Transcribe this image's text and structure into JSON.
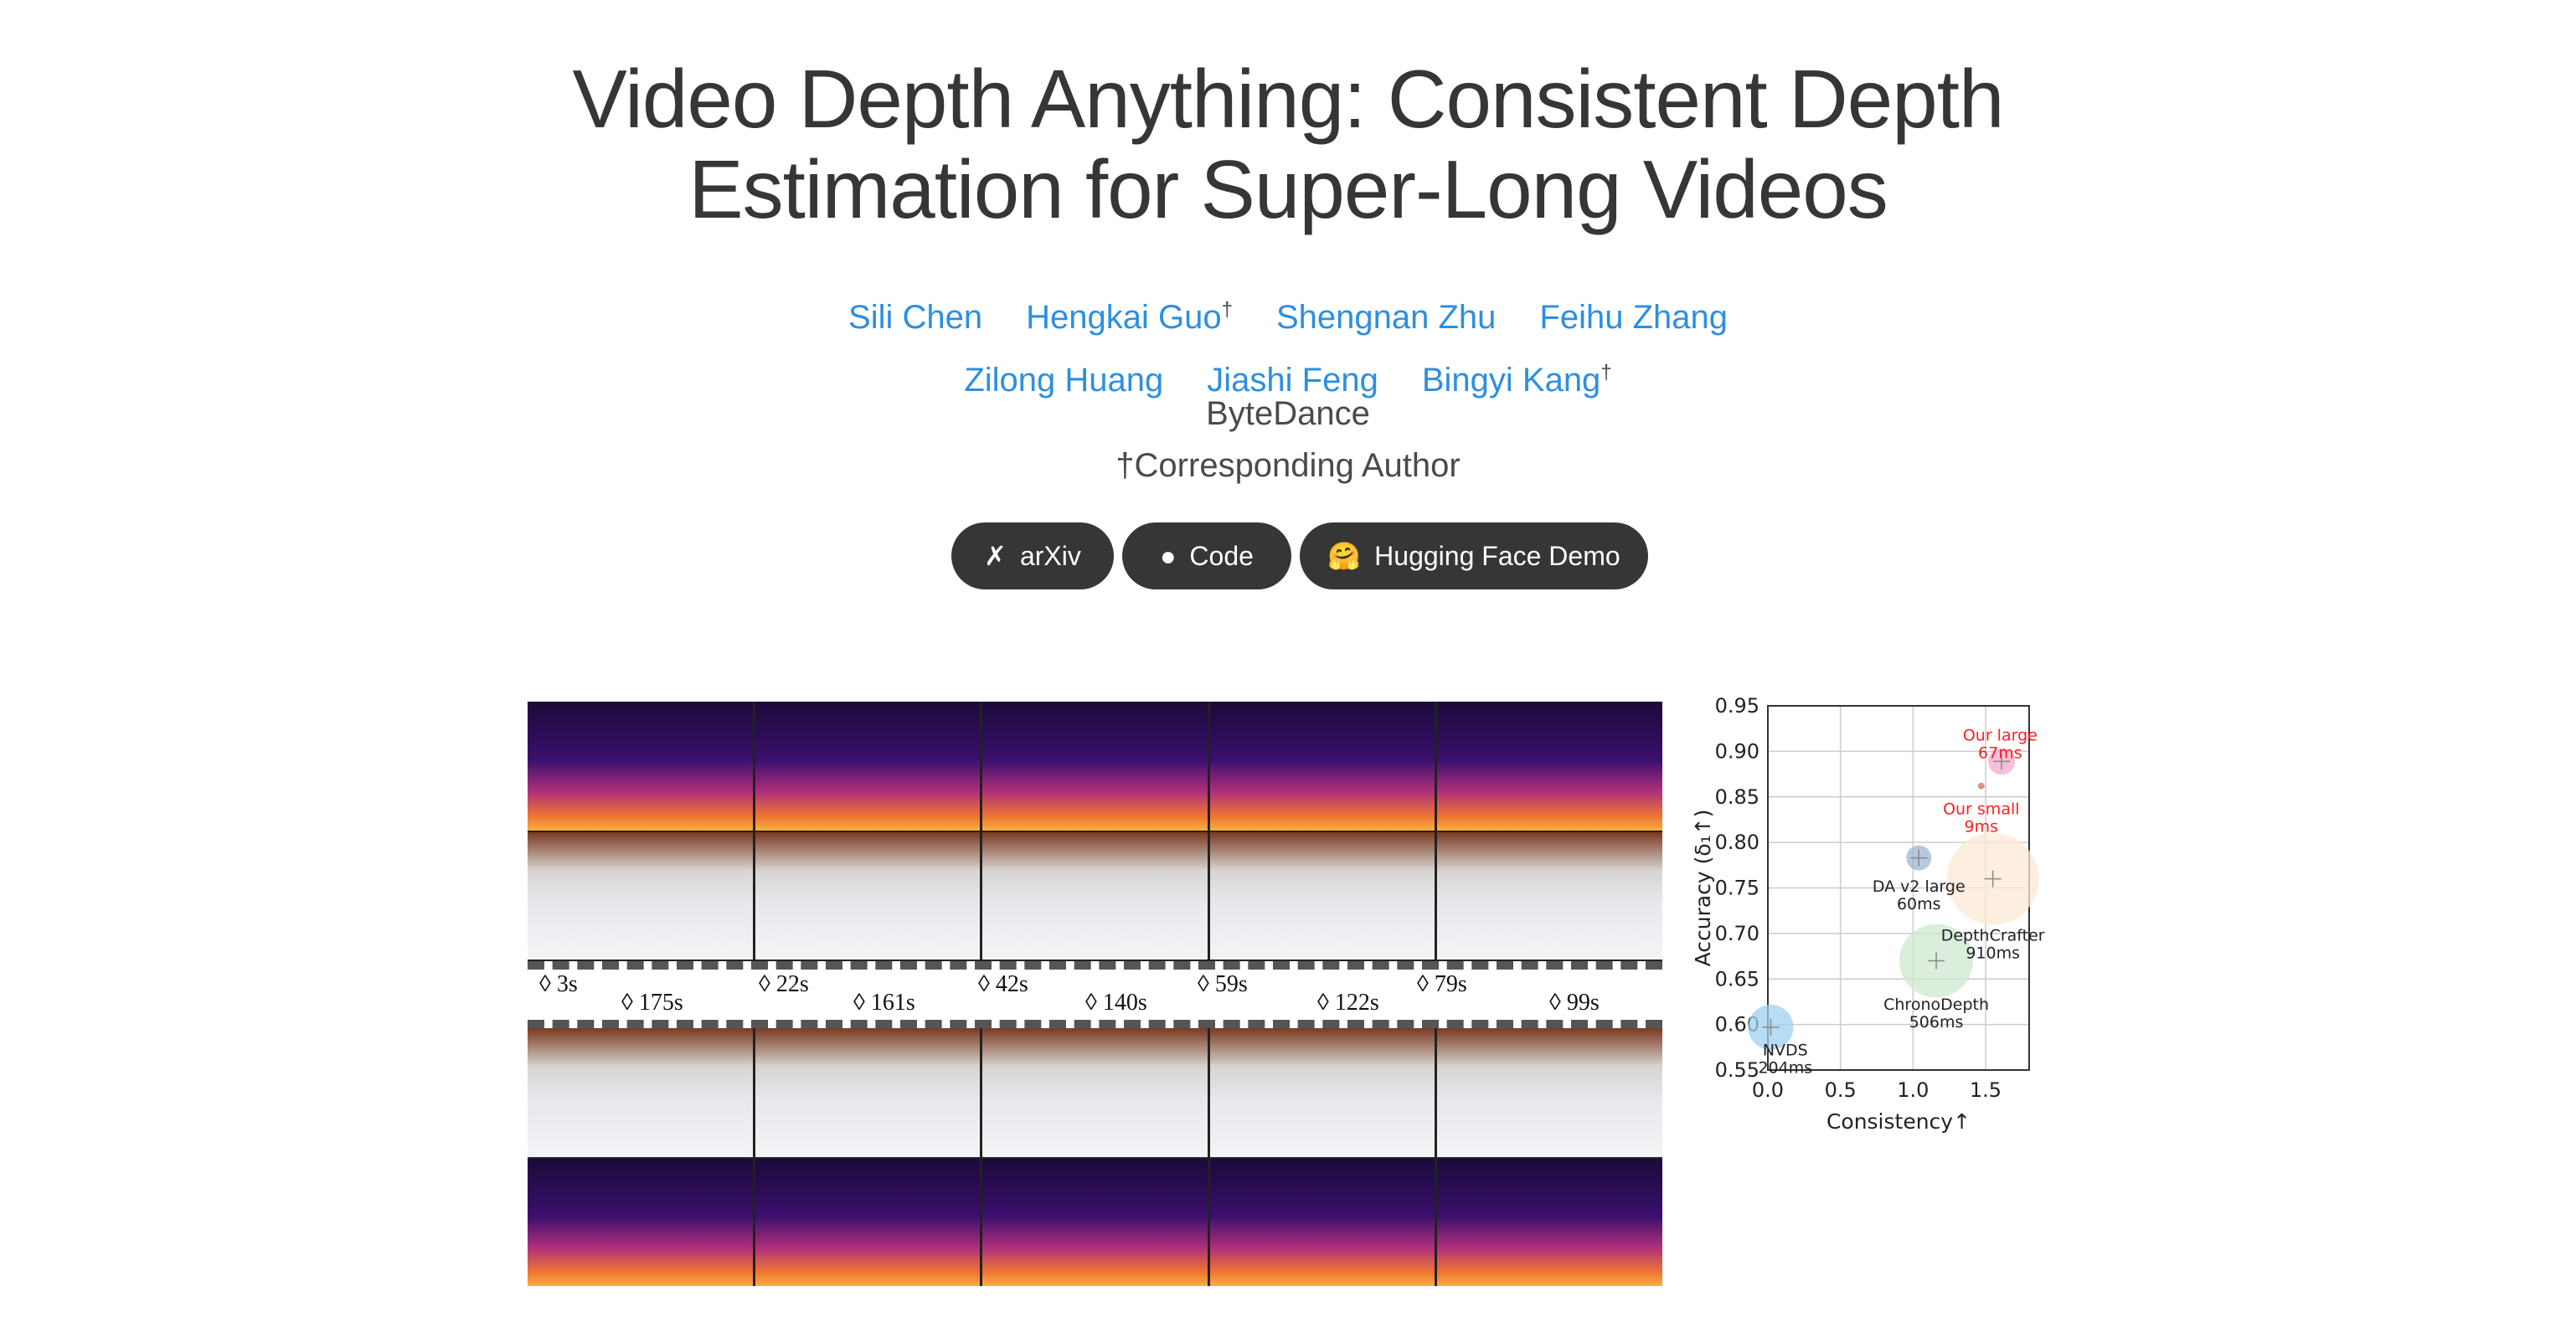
{
  "title": {
    "line1": "Video Depth Anything: Consistent Depth",
    "line2": "Estimation for Super-Long Videos"
  },
  "authors": {
    "row1": [
      {
        "name": "Sili Chen",
        "mark": ""
      },
      {
        "name": "Hengkai Guo",
        "mark": "†"
      },
      {
        "name": "Shengnan Zhu",
        "mark": ""
      },
      {
        "name": "Feihu Zhang",
        "mark": ""
      }
    ],
    "row2": [
      {
        "name": "Zilong Huang",
        "mark": ""
      },
      {
        "name": "Jiashi Feng",
        "mark": ""
      },
      {
        "name": "Bingyi Kang",
        "mark": "†"
      }
    ]
  },
  "affiliation": "ByteDance",
  "note": "†Corresponding Author",
  "buttons": [
    {
      "label": "arXiv",
      "icon": "arxiv-icon"
    },
    {
      "label": "Code",
      "icon": "github-icon"
    },
    {
      "label": "Hugging Face Demo",
      "icon": "hugging-face-icon"
    }
  ],
  "timeline": {
    "top": [
      "3s",
      "22s",
      "42s",
      "59s",
      "79s"
    ],
    "bottom": [
      "175s",
      "161s",
      "140s",
      "122s",
      "99s"
    ]
  },
  "chart_data": {
    "type": "scatter",
    "xlabel": "Consistency↑",
    "ylabel": "Accuracy (δ₁↑)",
    "xlim": [
      0,
      1.8
    ],
    "ylim": [
      0.55,
      0.95
    ],
    "xticks": [
      "0.0",
      "0.5",
      "1.0",
      "1.5"
    ],
    "yticks": [
      "0.55",
      "0.60",
      "0.65",
      "0.70",
      "0.75",
      "0.80",
      "0.85",
      "0.90",
      "0.95"
    ],
    "grid": true,
    "points": [
      {
        "name": "NVDS",
        "latency": "204ms",
        "x": 0.02,
        "y": 0.597,
        "color": "#9fd0f0",
        "label_color": "#222222"
      },
      {
        "name": "ChronoDepth",
        "latency": "506ms",
        "x": 1.16,
        "y": 0.67,
        "color": "#cfe8cf",
        "label_color": "#222222"
      },
      {
        "name": "DepthCrafter",
        "latency": "910ms",
        "x": 1.55,
        "y": 0.76,
        "color": "#fbe9d6",
        "label_color": "#222222"
      },
      {
        "name": "DA v2 large",
        "latency": "60ms",
        "x": 1.04,
        "y": 0.783,
        "color": "#9db6d2",
        "label_color": "#222222"
      },
      {
        "name": "Our large",
        "latency": "67ms",
        "x": 1.61,
        "y": 0.889,
        "color": "#f2a9cc",
        "label_color": "#ff2020"
      },
      {
        "name": "Our small",
        "latency": "9ms",
        "x": 1.47,
        "y": 0.862,
        "color": "#c27a50",
        "label_color": "#ff2020"
      }
    ]
  }
}
